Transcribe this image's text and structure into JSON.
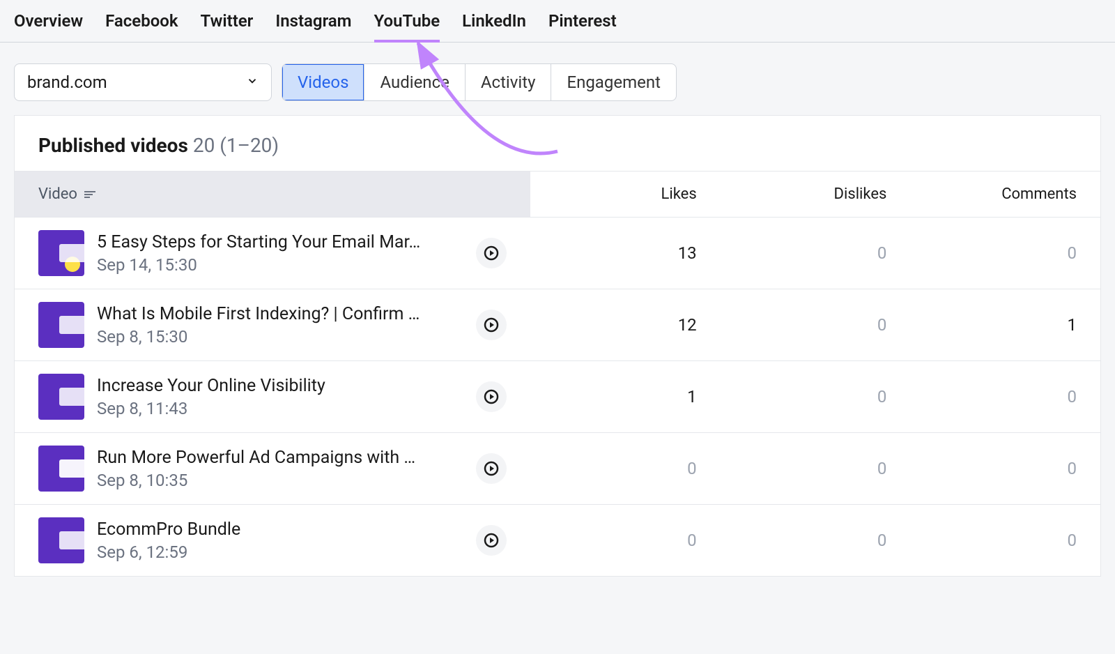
{
  "tabs": [
    {
      "label": "Overview",
      "active": false
    },
    {
      "label": "Facebook",
      "active": false
    },
    {
      "label": "Twitter",
      "active": false
    },
    {
      "label": "Instagram",
      "active": false
    },
    {
      "label": "YouTube",
      "active": true
    },
    {
      "label": "LinkedIn",
      "active": false
    },
    {
      "label": "Pinterest",
      "active": false
    }
  ],
  "selector": {
    "value": "brand.com"
  },
  "subtabs": [
    {
      "label": "Videos",
      "active": true
    },
    {
      "label": "Audience",
      "active": false
    },
    {
      "label": "Activity",
      "active": false
    },
    {
      "label": "Engagement",
      "active": false
    }
  ],
  "section": {
    "title": "Published videos",
    "count": "20 (1–20)"
  },
  "columns": {
    "video": "Video",
    "likes": "Likes",
    "dislikes": "Dislikes",
    "comments": "Comments"
  },
  "rows": [
    {
      "title": "5 Easy Steps for Starting Your Email Mar…",
      "date": "Sep 14, 15:30",
      "likes": "13",
      "dislikes": "0",
      "comments": "0"
    },
    {
      "title": "What Is Mobile First Indexing? | Confirm …",
      "date": "Sep 8, 15:30",
      "likes": "12",
      "dislikes": "0",
      "comments": "1"
    },
    {
      "title": "Increase Your Online Visibility",
      "date": "Sep 8, 11:43",
      "likes": "1",
      "dislikes": "0",
      "comments": "0"
    },
    {
      "title": "Run More Powerful Ad Campaigns with …",
      "date": "Sep 8, 10:35",
      "likes": "0",
      "dislikes": "0",
      "comments": "0"
    },
    {
      "title": "EcommPro Bundle",
      "date": "Sep 6, 12:59",
      "likes": "0",
      "dislikes": "0",
      "comments": "0"
    }
  ]
}
